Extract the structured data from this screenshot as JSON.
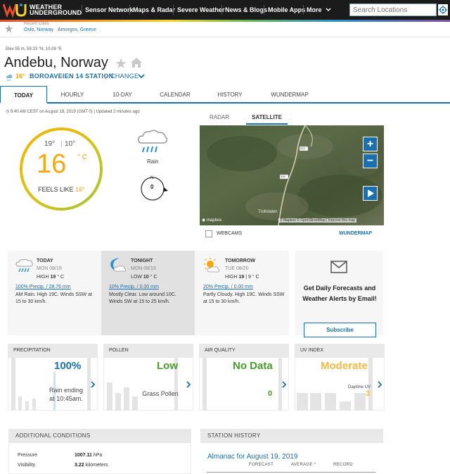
{
  "header": {
    "logo_line1": "WEATHER",
    "logo_line2": "UNDERGROUND",
    "nav": [
      "Sensor Network",
      "Maps & Radar",
      "Severe Weather",
      "News & Blogs",
      "Mobile Apps",
      "More"
    ],
    "search_placeholder": "Search Locations"
  },
  "recent": {
    "label": "Recent Cities",
    "cities": [
      "Oslo, Norway",
      "Amorgos, Greece"
    ]
  },
  "location": {
    "elevation": "Elev 55 m​, 59.33 °N, 10.09 °E",
    "city": "Andebu, Norway",
    "station_temp": "16°",
    "station_name": "BOROAVEIEN 14 STATION",
    "separator": "|",
    "change_label": "CHANGE"
  },
  "tabs": [
    "TODAY",
    "HOURLY",
    "10-DAY",
    "CALENDAR",
    "HISTORY",
    "WUNDERMAP"
  ],
  "current": {
    "updated": "9:40 AM CEST on August 19, 2019 (GMT 0) | Updated 2 minutes ago",
    "high": "19°",
    "sep": "|",
    "low": "10°",
    "temp": "16",
    "unit": "° C",
    "feels_like_label": "FEELS LIKE",
    "feels_like_value": "16°",
    "condition": "Rain",
    "wind_dir": "N",
    "wind_speed": "0"
  },
  "map": {
    "tabs": [
      "RADAR",
      "SATELLITE"
    ],
    "zoom_in": "+",
    "zoom_out": "−",
    "logo": "mapbox",
    "attribution": "© Mapbox © OpenStreetMap | Improve this map",
    "place": "Trollstalen",
    "road1": "333",
    "road2": "306",
    "webcams_label": "WEBCAMS",
    "wundermap_label": "WUNDERMAP"
  },
  "forecast": [
    {
      "title": "TODAY",
      "date": "MON 08/19",
      "hilo_prefix": "HIGH",
      "hilo_value": "19",
      "hilo_suffix": "° C",
      "precip": "100% Precip. / 28.76 mm",
      "desc": "AM Rain. High 19C. Winds SSW at 15 to 30 km/h."
    },
    {
      "title": "TONIGHT",
      "date": "MON 08/19",
      "hilo_prefix": "LOW",
      "hilo_value": "10",
      "hilo_suffix": "° C",
      "precip": "10% Precip. / 0.00 mm",
      "desc": "Mostly Clear. Low around 10C. Winds SW at 15 to 25 km/h."
    },
    {
      "title": "TOMORROW",
      "date": "TUE 08/20",
      "hilo_prefix": "HIGH",
      "hilo_value": "19",
      "hilo_suffix": "| 9 ° C",
      "precip": "20% Precip. / 0.00 mm",
      "desc": "Partly Cloudy. High 19C. Winds SSW at 15 to 30 km/h."
    }
  ],
  "email": {
    "text": "Get Daily Forecasts and Weather Alerts by Email!",
    "button": "Subscribe"
  },
  "tiles": [
    {
      "title": "PRECIPITATION",
      "value": "100%",
      "sub1": "Rain ending",
      "sub2": "at 10:45am."
    },
    {
      "title": "POLLEN",
      "value": "Low",
      "sub1": "Grass Pollen",
      "sub2": ""
    },
    {
      "title": "AIR QUALITY",
      "value": "No Data",
      "sub1": "0",
      "sub2": ""
    },
    {
      "title": "UV INDEX",
      "value": "Moderate",
      "sub1": "Daytime UV",
      "sub2": "3"
    }
  ],
  "additional": {
    "title": "ADDITIONAL CONDITIONS",
    "rows": [
      {
        "label": "Pressure",
        "value": "1007.11",
        "unit": "hPa"
      },
      {
        "label": "Visibility",
        "value": "3.22",
        "unit": "kilometers"
      }
    ]
  },
  "history": {
    "title": "STATION HISTORY",
    "almanac": "Almanac for August 19, 2019",
    "columns": [
      "FORECAST",
      "AVERAGE *",
      "RECORD"
    ]
  },
  "colors": {
    "accent": "#1a6fae",
    "temp": "#f5a80f",
    "green": "#4a9a2c",
    "uv": "#f5b942"
  }
}
